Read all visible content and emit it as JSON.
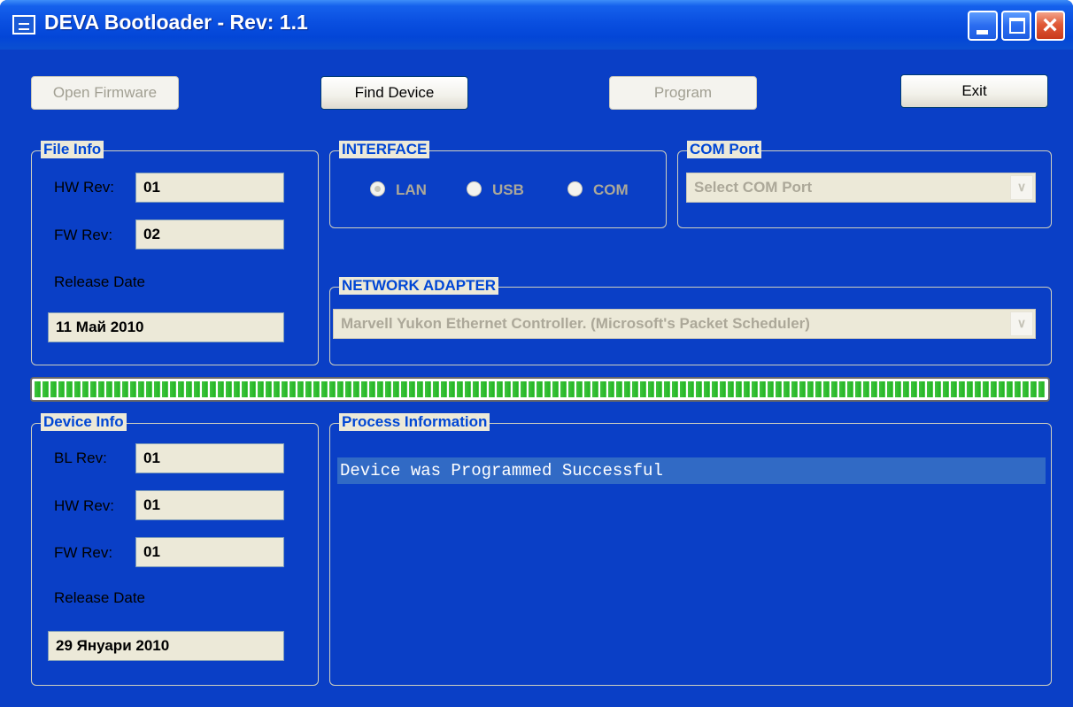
{
  "window": {
    "title": "DEVA Bootloader - Rev: 1.1"
  },
  "toolbar": {
    "open_firmware": "Open Firmware",
    "find_device": "Find Device",
    "program": "Program",
    "exit": "Exit"
  },
  "file_info": {
    "label": "File Info",
    "hw_rev_label": "HW Rev:",
    "hw_rev": "01",
    "fw_rev_label": "FW Rev:",
    "fw_rev": "02",
    "release_date_label": "Release Date",
    "release_date": "11 Май 2010"
  },
  "interface": {
    "label": "INTERFACE",
    "options": [
      "LAN",
      "USB",
      "COM"
    ],
    "selected": "LAN"
  },
  "com_port": {
    "label": "COM Port",
    "value": "Select COM Port"
  },
  "network_adapter": {
    "label": "NETWORK ADAPTER",
    "value": "Marvell Yukon Ethernet Controller. (Microsoft's Packet Scheduler)"
  },
  "progress": {
    "value": 1.0
  },
  "device_info": {
    "label": "Device Info",
    "bl_rev_label": "BL Rev:",
    "bl_rev": "01",
    "hw_rev_label": "HW Rev:",
    "hw_rev": "01",
    "fw_rev_label": "FW Rev:",
    "fw_rev": "01",
    "release_date_label": "Release Date",
    "release_date": "29 Януари 2010"
  },
  "process_info": {
    "label": "Process Information",
    "lines": [
      "Device was Programmed Successful"
    ]
  },
  "colors": {
    "title_bar": "#0a4fe0",
    "group_label": "#0046d5",
    "selection": "#316ac5",
    "progress": "#25b525",
    "background": "#ece9d8"
  },
  "icons": [
    "app-icon",
    "minimize-icon",
    "maximize-icon",
    "close-icon",
    "dropdown-arrow-icon"
  ]
}
